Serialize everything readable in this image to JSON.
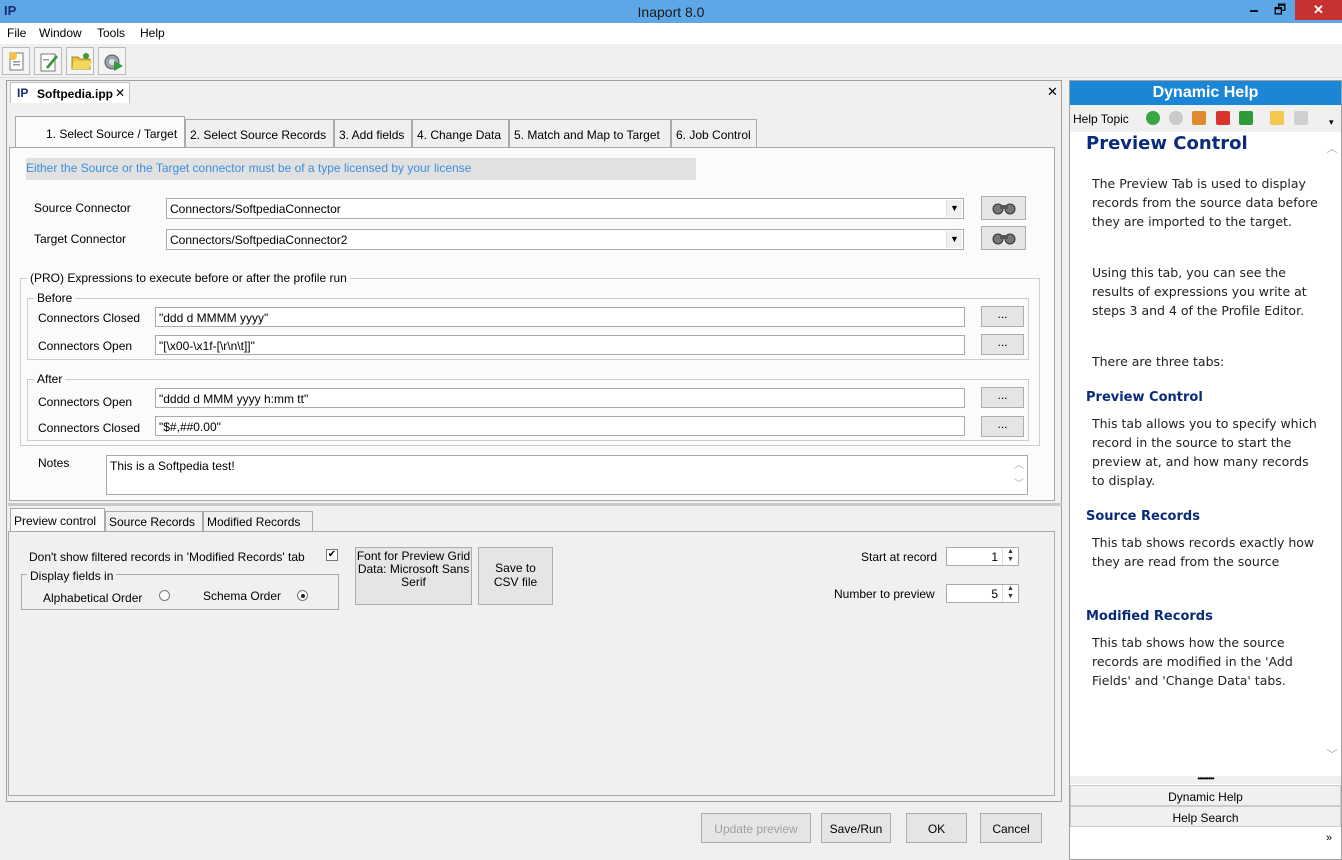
{
  "window": {
    "title": "Inaport 8.0",
    "app_icon": "IP",
    "minimize": "🗕",
    "restore": "🗗",
    "close": "✕"
  },
  "menu": [
    "File",
    "Window",
    "Tools",
    "Help"
  ],
  "toolbar": {
    "icons": [
      "new-document-icon",
      "edit-document-icon",
      "open-folder-icon",
      "settings-gear-icon"
    ]
  },
  "document": {
    "tab_label": "Softpedia.ipp",
    "tab_close": "✕",
    "panel_close": "✕"
  },
  "steps": [
    "1. Select Source / Target",
    "2. Select Source Records",
    "3. Add fields",
    "4. Change Data",
    "5. Match and Map to Target",
    "6. Job Control"
  ],
  "license_note": "Either the Source or the Target connector must be of a type licensed by your license",
  "source_connector": {
    "label": "Source Connector",
    "value": "Connectors/SoftpediaConnector"
  },
  "target_connector": {
    "label": "Target Connector",
    "value": "Connectors/SoftpediaConnector2"
  },
  "pro_group": {
    "label": "(PRO) Expressions to execute before or after the profile run",
    "before": {
      "label": "Before",
      "connectors_closed": {
        "label": "Connectors Closed",
        "value": "\"ddd d MMMM yyyy\""
      },
      "connectors_open": {
        "label": "Connectors Open",
        "value": "\"[\\x00-\\x1f-[\\r\\n\\t]]\""
      }
    },
    "after": {
      "label": "After",
      "connectors_open": {
        "label": "Connectors Open",
        "value": "\"dddd d MMM yyyy h:mm tt\""
      },
      "connectors_closed": {
        "label": "Connectors Closed",
        "value": "\"$#,##0.00\""
      }
    },
    "ellipsis": "..."
  },
  "notes": {
    "label": "Notes",
    "value": "This is a Softpedia test!"
  },
  "preview_tabs": [
    "Preview control",
    "Source Records",
    "Modified Records"
  ],
  "preview": {
    "dont_show_filtered": {
      "label": "Don't show filtered records in 'Modified Records' tab",
      "checked": true
    },
    "display_fields": {
      "label": "Display fields in",
      "alphabetical": "Alphabetical Order",
      "schema": "Schema Order",
      "selected": "schema"
    },
    "font_button": "Font for Preview Grid Data: Microsoft Sans Serif",
    "save_csv_button": "Save to CSV file",
    "start_at_record": {
      "label": "Start at record",
      "value": "1"
    },
    "number_to_preview": {
      "label": "Number to preview",
      "value": "5"
    }
  },
  "actions": {
    "update_preview": "Update preview",
    "save_run": "Save/Run",
    "ok": "OK",
    "cancel": "Cancel"
  },
  "help": {
    "header": "Dynamic Help",
    "topic_label": "Help Topic",
    "title": "Preview Control",
    "p1": "The Preview Tab is used to display records from the source data before they are imported to the target.",
    "p2": "Using this tab, you can see the results of expressions you write at steps 3 and 4 of the Profile Editor.",
    "p3": "There are three tabs:",
    "h_preview": "Preview Control",
    "p_preview": "This tab allows you to specify which record in the source to start the preview at, and how many records to display.",
    "h_source": "Source Records",
    "p_source": "This tab shows records exactly how they are read from the source",
    "h_modified": "Modified Records",
    "p_modified": "This tab shows how the source records are modified in the 'Add Fields' and 'Change Data' tabs.",
    "bottom_tabs": [
      "Dynamic Help",
      "Help Search"
    ]
  }
}
